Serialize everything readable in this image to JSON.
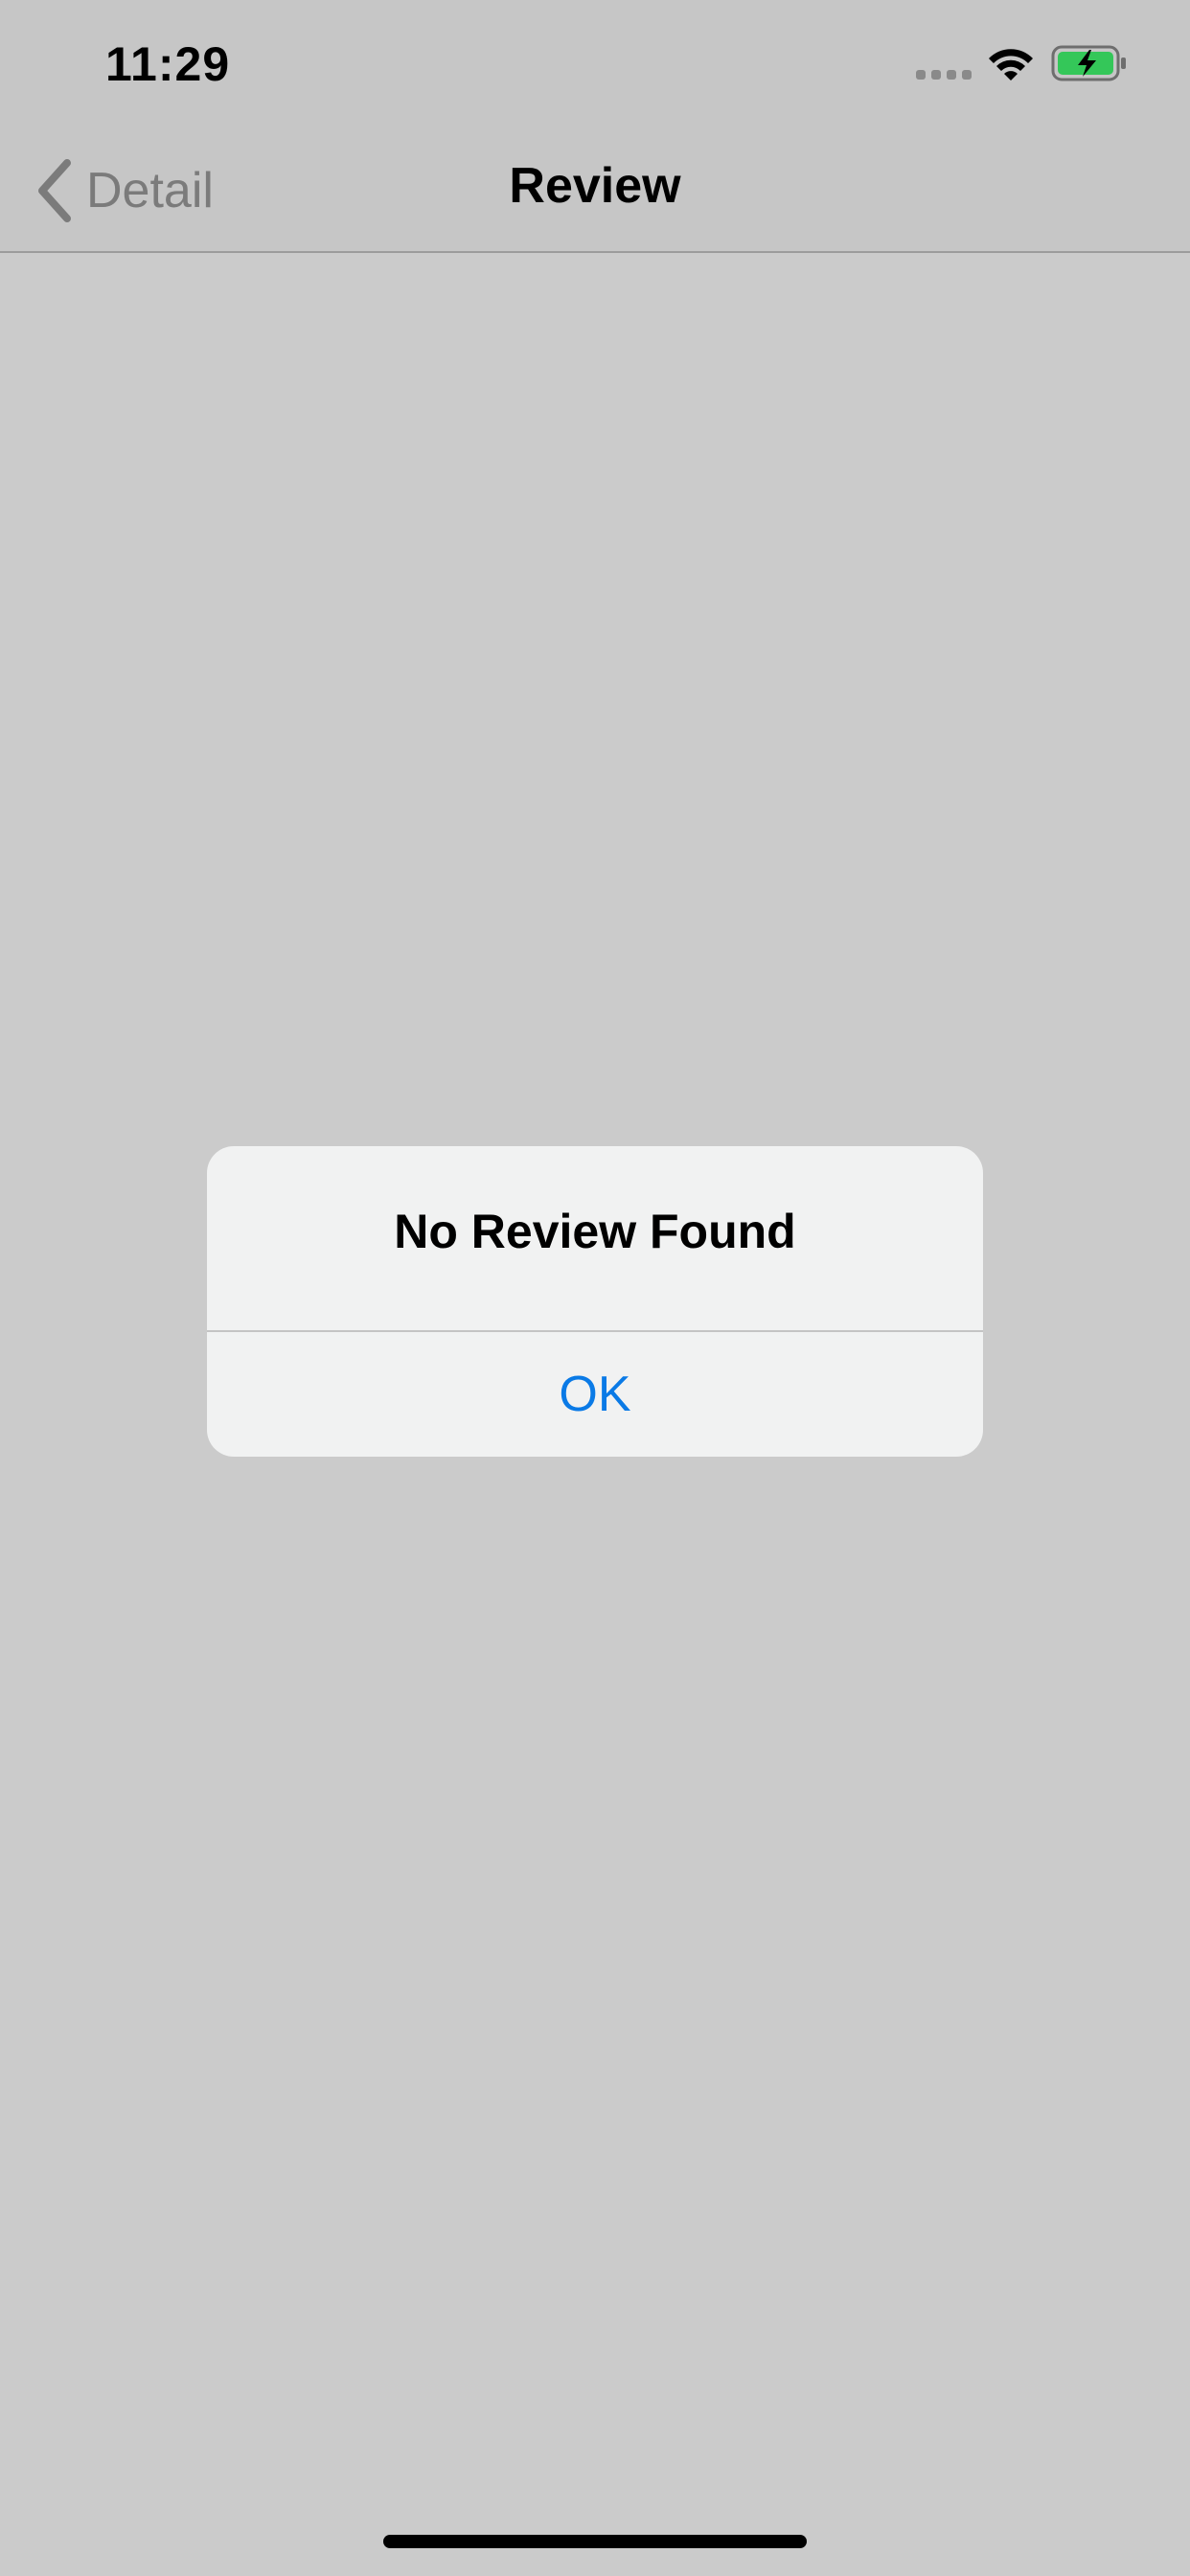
{
  "status_bar": {
    "time": "11:29",
    "icons": [
      "signal-dots-icon",
      "wifi-icon",
      "battery-charging-icon"
    ],
    "battery_color": "#34c759"
  },
  "nav": {
    "back_label": "Detail",
    "title": "Review"
  },
  "alert": {
    "title": "No Review Found",
    "ok_label": "OK",
    "ok_color": "#0a7ae6"
  }
}
